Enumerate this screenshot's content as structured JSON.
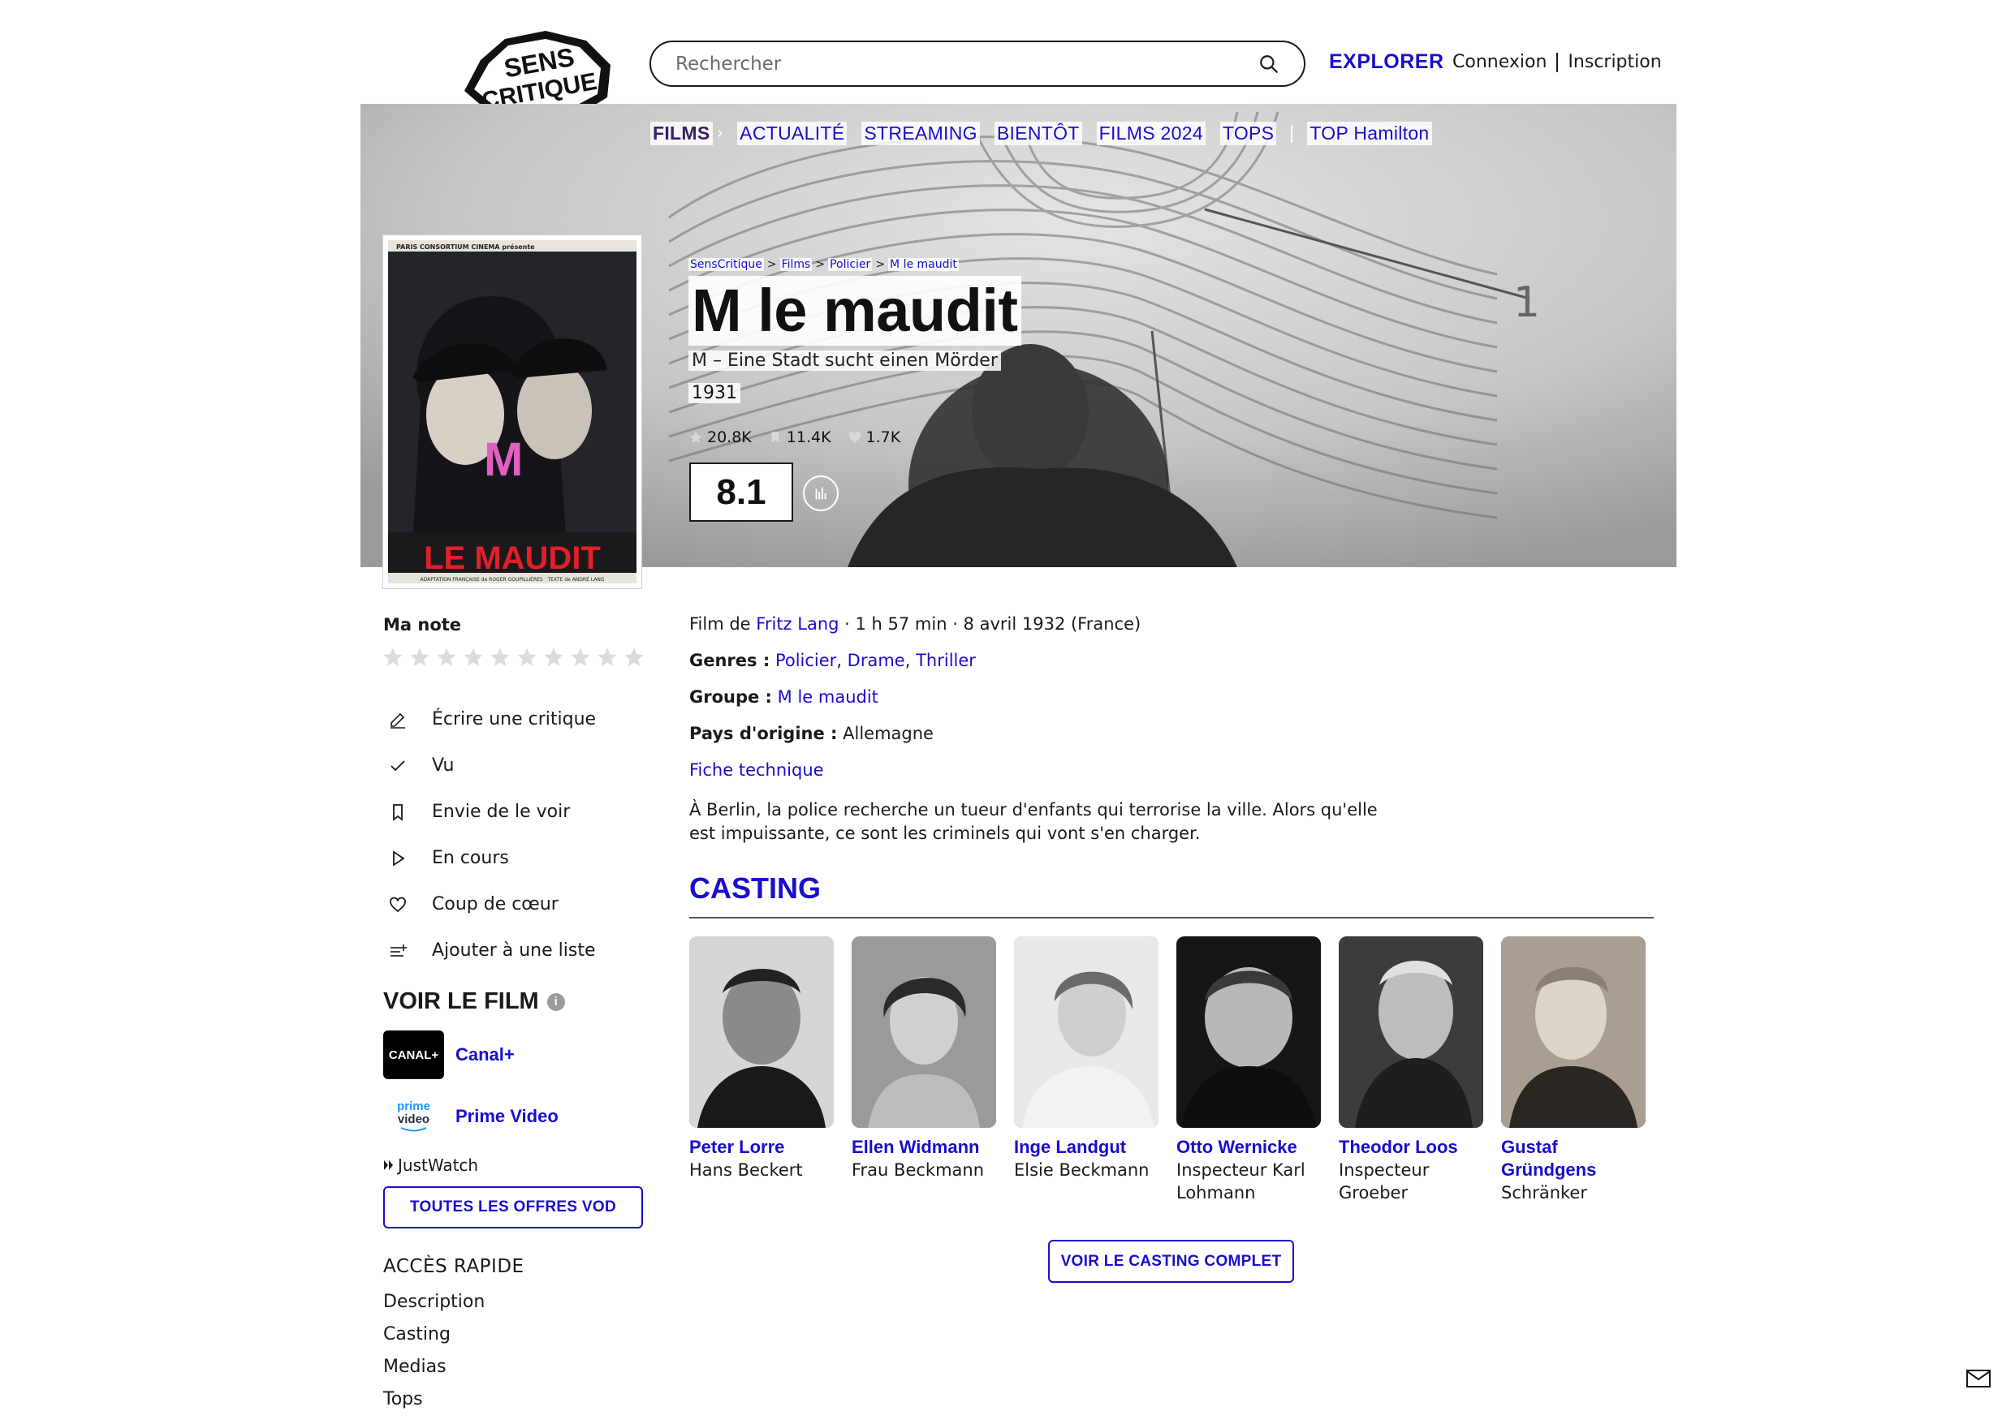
{
  "header": {
    "logo_text": "SENS CRITIQUE",
    "search_placeholder": "Rechercher",
    "explorer": "EXPLORER",
    "connexion": "Connexion",
    "inscription": "Inscription"
  },
  "nav": {
    "items": [
      {
        "label": "FILMS",
        "active": true
      },
      {
        "label": "ACTUALITÉ"
      },
      {
        "label": "STREAMING"
      },
      {
        "label": "BIENTÔT"
      },
      {
        "label": "FILMS 2024"
      },
      {
        "label": "TOPS"
      },
      {
        "label": "TOP Hamilton"
      }
    ]
  },
  "breadcrumb": [
    "SensCritique",
    "Films",
    "Policier",
    "M le maudit"
  ],
  "film": {
    "title": "M le maudit",
    "original_title": "M – Eine Stadt sucht einen Mörder",
    "year": "1931",
    "stats": {
      "ratings": "20.8K",
      "wishlist": "11.4K",
      "likes": "1.7K"
    },
    "score": "8.1",
    "poster_text": "LE MAUDIT",
    "poster_letter": "M",
    "poster_top_text": "PARIS CONSORTIUM CINEMA présente",
    "poster_bottom_text": "ADAPTATION FRANÇAISE de ROGER GOUPILLIÈRES · TEXTE de ANDRÉ LANG",
    "director_prefix": "Film de",
    "director": "Fritz Lang",
    "details": "· 1 h 57 min · 8 avril 1932 (France)",
    "genres_label": "Genres :",
    "genres": [
      "Policier",
      "Drame",
      "Thriller"
    ],
    "group_label": "Groupe :",
    "group": "M le maudit",
    "country_label": "Pays d'origine :",
    "country": "Allemagne",
    "fiche": "Fiche technique",
    "synopsis": "À Berlin, la police recherche un tueur d'enfants qui terrorise la ville. Alors qu'elle est impuissante, ce sont les criminels qui vont s'en charger."
  },
  "my_rating": {
    "label": "Ma note",
    "star_count": 10,
    "value": 0
  },
  "actions": [
    {
      "label": "Écrire une critique",
      "icon": "pencil-icon"
    },
    {
      "label": "Vu",
      "icon": "check-icon"
    },
    {
      "label": "Envie de le voir",
      "icon": "bookmark-icon"
    },
    {
      "label": "En cours",
      "icon": "play-icon"
    },
    {
      "label": "Coup de cœur",
      "icon": "heart-icon"
    },
    {
      "label": "Ajouter à une liste",
      "icon": "list-add-icon"
    }
  ],
  "voir": {
    "title": "VOIR LE FILM",
    "info": "i",
    "providers": [
      {
        "name": "Canal+",
        "logo_text": "CANAL+"
      },
      {
        "name": "Prime Video",
        "logo_text_top": "prime",
        "logo_text_bottom": "video"
      }
    ],
    "justwatch": "JustWatch",
    "button": "TOUTES LES OFFRES VOD"
  },
  "acces": {
    "title": "ACCÈS RAPIDE",
    "items": [
      "Description",
      "Casting",
      "Medias",
      "Tops"
    ]
  },
  "casting": {
    "title": "CASTING",
    "members": [
      {
        "name": "Peter Lorre",
        "role": "Hans Beckert"
      },
      {
        "name": "Ellen Widmann",
        "role": "Frau Beckmann"
      },
      {
        "name": "Inge Landgut",
        "role": "Elsie Beckmann"
      },
      {
        "name": "Otto Wernicke",
        "role": "Inspecteur Karl Lohmann"
      },
      {
        "name": "Theodor Loos",
        "role": "Inspecteur Groeber"
      },
      {
        "name": "Gustaf Gründgens",
        "role": "Schränker"
      }
    ],
    "button": "VOIR LE CASTING COMPLET"
  },
  "colors": {
    "accent": "#1a0dce",
    "nav_active": "#3a1f6b",
    "poster_red": "#e0202a",
    "poster_pink": "#e060c0"
  }
}
